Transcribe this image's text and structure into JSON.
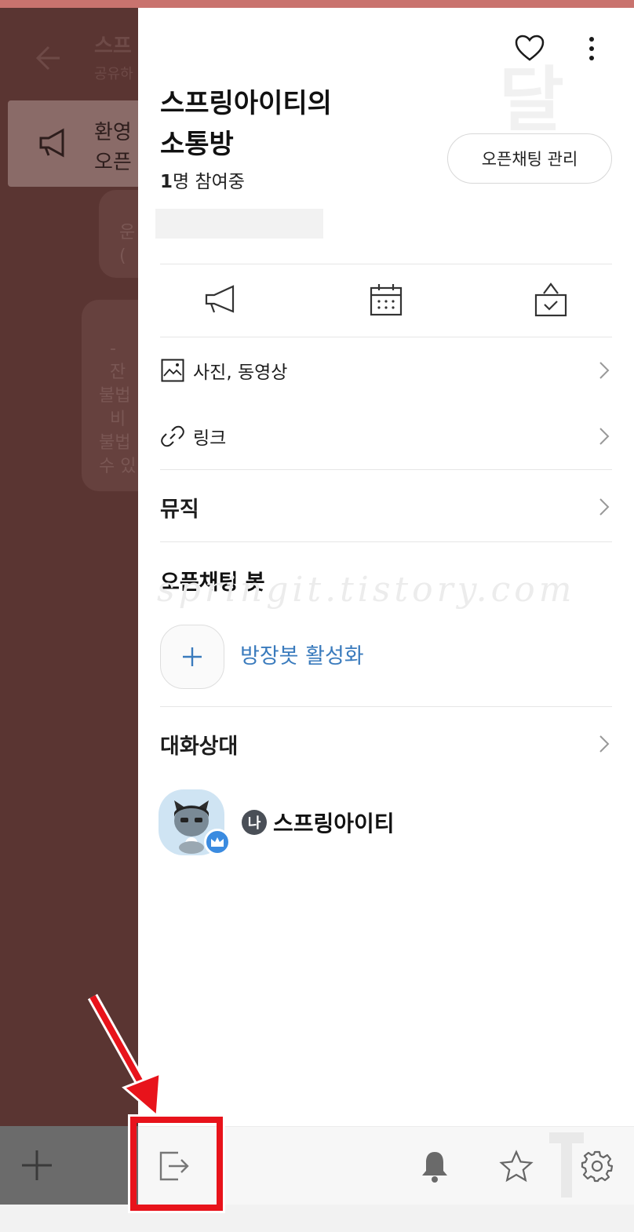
{
  "background_chat": {
    "title": "스프",
    "subtitle": "공유하",
    "notice_text": "환영\n오픈",
    "bubble1_text": "운\n(",
    "bubble2_text": "  -\n  잔\n불법\n  비\n불법\n수 있"
  },
  "drawer": {
    "room_title": "스프링아이티의\n소통방",
    "member_count": "1",
    "member_suffix": "명 참여중",
    "manage_button": "오픈채팅 관리",
    "media_rows": [
      {
        "label": "사진, 동영상",
        "icon": "photo-icon"
      },
      {
        "label": "링크",
        "icon": "link-icon"
      },
      {
        "label": "뮤직",
        "icon": ""
      }
    ],
    "bot_section_title": "오픈채팅 봇",
    "bot_activate_label": "방장봇 활성화",
    "members_section_title": "대화상대",
    "member": {
      "me_badge": "나",
      "name": "스프링아이티"
    },
    "watermark": "springit.tistory.com",
    "watermark_top": "달"
  },
  "icons": {
    "quick_actions": [
      "megaphone-icon",
      "calendar-icon",
      "vote-icon"
    ],
    "bottom_bar": [
      "exit-icon",
      "bell-icon",
      "star-icon",
      "gear-icon"
    ]
  },
  "colors": {
    "accent_blue": "#3a7bbd",
    "highlight_red": "#e8131b",
    "dim_overlay": "#5a3532"
  }
}
